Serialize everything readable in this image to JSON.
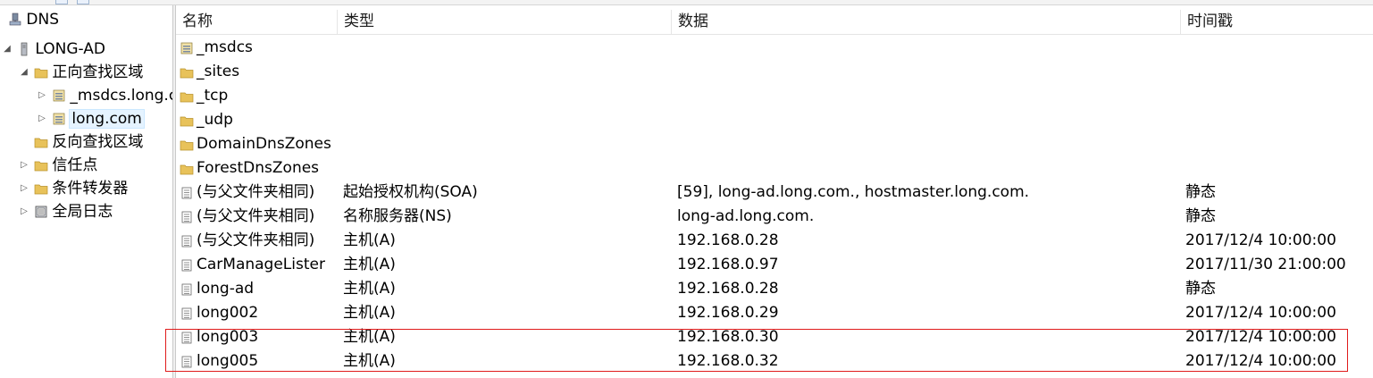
{
  "tree": {
    "nodes": [
      {
        "label": "DNS",
        "icon": "dns-root-icon",
        "arrow": ""
      },
      {
        "label": "LONG-AD",
        "icon": "server-icon",
        "arrow": "◢"
      },
      {
        "label": "正向查找区域",
        "icon": "folder-icon",
        "arrow": "◢"
      },
      {
        "label": "_msdcs.long.c",
        "icon": "zone-icon",
        "arrow": "▷"
      },
      {
        "label": "long.com",
        "icon": "zone-icon",
        "arrow": "▷"
      },
      {
        "label": "反向查找区域",
        "icon": "folder-icon",
        "arrow": ""
      },
      {
        "label": "信任点",
        "icon": "folder-icon",
        "arrow": "▷"
      },
      {
        "label": "条件转发器",
        "icon": "folder-icon",
        "arrow": "▷"
      },
      {
        "label": "全局日志",
        "icon": "log-icon",
        "arrow": "▷"
      }
    ]
  },
  "list": {
    "columns": [
      "名称",
      "类型",
      "数据",
      "时间戳"
    ],
    "rows": [
      {
        "icon": "zone-icon",
        "name": "_msdcs",
        "type": "",
        "data": "",
        "time": ""
      },
      {
        "icon": "folder-icon",
        "name": "_sites",
        "type": "",
        "data": "",
        "time": ""
      },
      {
        "icon": "folder-icon",
        "name": "_tcp",
        "type": "",
        "data": "",
        "time": ""
      },
      {
        "icon": "folder-icon",
        "name": "_udp",
        "type": "",
        "data": "",
        "time": ""
      },
      {
        "icon": "folder-icon",
        "name": "DomainDnsZones",
        "type": "",
        "data": "",
        "time": ""
      },
      {
        "icon": "folder-icon",
        "name": "ForestDnsZones",
        "type": "",
        "data": "",
        "time": ""
      },
      {
        "icon": "record-icon",
        "name": "(与父文件夹相同)",
        "type": "起始授权机构(SOA)",
        "data": "[59], long-ad.long.com., hostmaster.long.com.",
        "time": "静态"
      },
      {
        "icon": "record-icon",
        "name": "(与父文件夹相同)",
        "type": "名称服务器(NS)",
        "data": "long-ad.long.com.",
        "time": "静态"
      },
      {
        "icon": "record-icon",
        "name": "(与父文件夹相同)",
        "type": "主机(A)",
        "data": "192.168.0.28",
        "time": "2017/12/4 10:00:00"
      },
      {
        "icon": "record-icon",
        "name": "CarManageLister",
        "type": "主机(A)",
        "data": "192.168.0.97",
        "time": "2017/11/30 21:00:00"
      },
      {
        "icon": "record-icon",
        "name": "long-ad",
        "type": "主机(A)",
        "data": "192.168.0.28",
        "time": "静态"
      },
      {
        "icon": "record-icon",
        "name": "long002",
        "type": "主机(A)",
        "data": "192.168.0.29",
        "time": "2017/12/4 10:00:00"
      },
      {
        "icon": "record-icon",
        "name": "long003",
        "type": "主机(A)",
        "data": "192.168.0.30",
        "time": "2017/12/4 10:00:00"
      },
      {
        "icon": "record-icon",
        "name": "long005",
        "type": "主机(A)",
        "data": "192.168.0.32",
        "time": "2017/12/4 10:00:00"
      }
    ]
  },
  "colors": {
    "highlight_border": "#e01b1b",
    "folder": "#e8c25a",
    "selected_bg": "#e5f3ff"
  }
}
